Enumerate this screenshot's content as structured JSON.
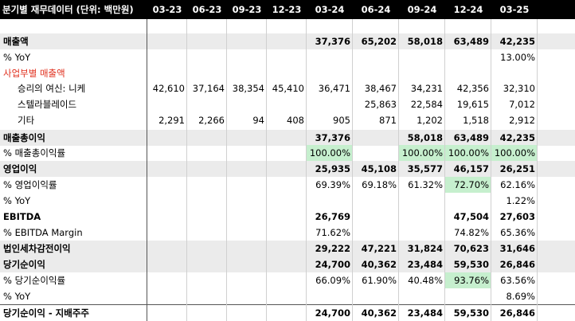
{
  "header": {
    "label": "분기별 재무데이터 (단위: 백만원)",
    "quarters": [
      "03-23",
      "06-23",
      "09-23",
      "12-23",
      "03-24",
      "06-24",
      "09-24",
      "12-24",
      "03-25"
    ]
  },
  "rows": [
    {
      "key": "blank",
      "label": "",
      "values": [
        "",
        "",
        "",
        "",
        "",
        "",
        "",
        "",
        ""
      ]
    },
    {
      "key": "revenue",
      "label": "매출액",
      "style": "bold shaded",
      "values": [
        "",
        "",
        "",
        "",
        "37,376",
        "65,202",
        "58,018",
        "63,489",
        "42,235"
      ]
    },
    {
      "key": "revenue-yoy",
      "label": "% YoY",
      "values": [
        "",
        "",
        "",
        "",
        "",
        "",
        "",
        "",
        "13.00%"
      ]
    },
    {
      "key": "segment-header",
      "label": "사업부별 매출액",
      "style": "red",
      "values": [
        "",
        "",
        "",
        "",
        "",
        "",
        "",
        "",
        ""
      ]
    },
    {
      "key": "segment-nickel",
      "label": "승리의 여신: 니케",
      "style": "indent",
      "values": [
        "42,610",
        "37,164",
        "38,354",
        "45,410",
        "36,471",
        "38,467",
        "34,231",
        "42,356",
        "32,310"
      ]
    },
    {
      "key": "segment-stellar",
      "label": "스텔라블레이드",
      "style": "indent",
      "values": [
        "",
        "",
        "",
        "",
        "",
        "25,863",
        "22,584",
        "19,615",
        "7,012"
      ]
    },
    {
      "key": "segment-other",
      "label": "기타",
      "style": "indent",
      "values": [
        "2,291",
        "2,266",
        "94",
        "408",
        "905",
        "871",
        "1,202",
        "1,518",
        "2,912"
      ]
    },
    {
      "key": "gross-profit",
      "label": "매출총이익",
      "style": "bold shaded",
      "values": [
        "",
        "",
        "",
        "",
        "37,376",
        "",
        "58,018",
        "63,489",
        "42,235"
      ]
    },
    {
      "key": "gross-margin",
      "label": "% 매출총이익률",
      "values": [
        "",
        "",
        "",
        "",
        "100.00%",
        "",
        "100.00%",
        "100.00%",
        "100.00%"
      ],
      "green": [
        4,
        6,
        7,
        8
      ]
    },
    {
      "key": "operating-profit",
      "label": "영업이익",
      "style": "bold shaded",
      "values": [
        "",
        "",
        "",
        "",
        "25,935",
        "45,108",
        "35,577",
        "46,157",
        "26,251"
      ]
    },
    {
      "key": "operating-margin",
      "label": "% 영업이익률",
      "values": [
        "",
        "",
        "",
        "",
        "69.39%",
        "69.18%",
        "61.32%",
        "72.70%",
        "62.16%"
      ],
      "green": [
        7
      ]
    },
    {
      "key": "operating-yoy",
      "label": "% YoY",
      "values": [
        "",
        "",
        "",
        "",
        "",
        "",
        "",
        "",
        "1.22%"
      ]
    },
    {
      "key": "ebitda",
      "label": "EBITDA",
      "style": "bold",
      "values": [
        "",
        "",
        "",
        "",
        "26,769",
        "",
        "",
        "47,504",
        "27,603"
      ]
    },
    {
      "key": "ebitda-margin",
      "label": "% EBITDA Margin",
      "values": [
        "",
        "",
        "",
        "",
        "71.62%",
        "",
        "",
        "74.82%",
        "65.36%"
      ]
    },
    {
      "key": "pretax-income",
      "label": "법인세차감전이익",
      "style": "bold shaded",
      "values": [
        "",
        "",
        "",
        "",
        "29,222",
        "47,221",
        "31,824",
        "70,623",
        "31,646"
      ]
    },
    {
      "key": "net-income",
      "label": "당기순이익",
      "style": "bold shaded",
      "values": [
        "",
        "",
        "",
        "",
        "24,700",
        "40,362",
        "23,484",
        "59,530",
        "26,846"
      ]
    },
    {
      "key": "net-margin",
      "label": "% 당기순이익률",
      "values": [
        "",
        "",
        "",
        "",
        "66.09%",
        "61.90%",
        "40.48%",
        "93.76%",
        "63.56%"
      ],
      "green": [
        7
      ]
    },
    {
      "key": "net-yoy",
      "label": "% YoY",
      "values": [
        "",
        "",
        "",
        "",
        "",
        "",
        "",
        "",
        "8.69%"
      ]
    },
    {
      "key": "net-income-parent",
      "label": "당기순이익 - 지배주주",
      "style": "bold topline",
      "values": [
        "",
        "",
        "",
        "",
        "24,700",
        "40,362",
        "23,484",
        "59,530",
        "26,846"
      ]
    }
  ]
}
